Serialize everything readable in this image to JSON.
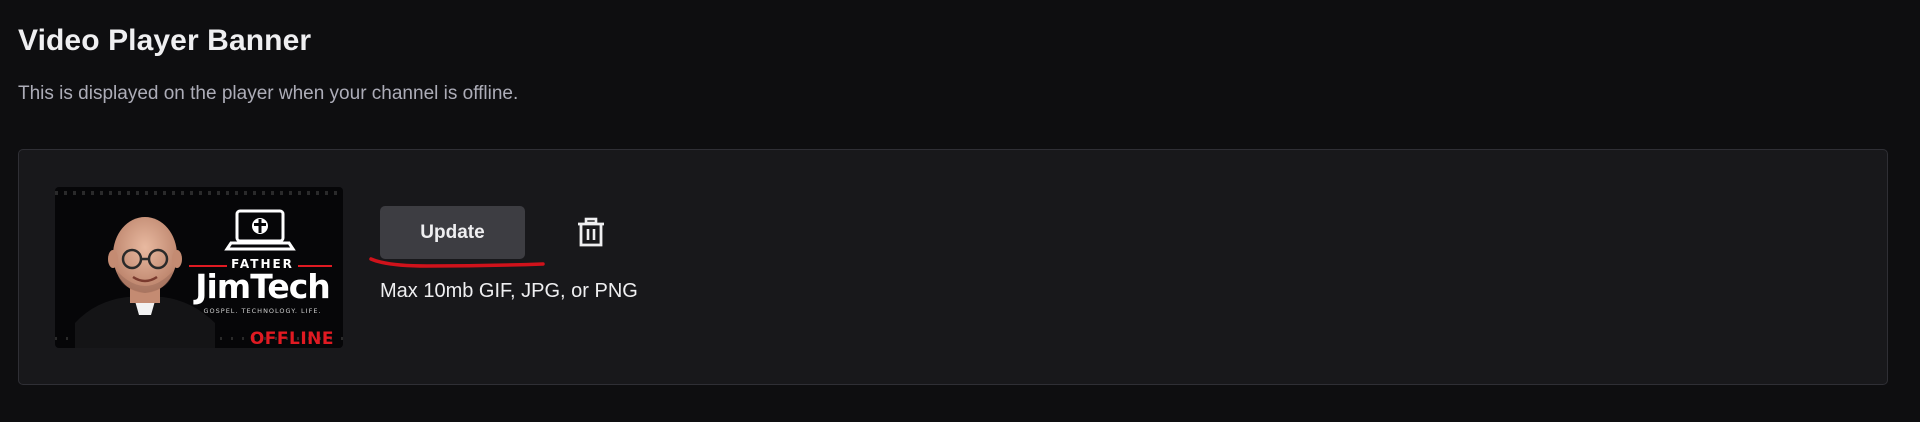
{
  "section": {
    "title": "Video Player Banner",
    "description": "This is displayed on the player when your channel is offline."
  },
  "banner": {
    "image_alt": "Father JimTech offline banner",
    "brand_top": "FATHER",
    "brand_name": "JimTech",
    "brand_tagline": "GOSPEL. TECHNOLOGY. LIFE.",
    "status_text": "OFFLINE"
  },
  "actions": {
    "update_label": "Update",
    "delete_icon": "trash-icon"
  },
  "upload_hint": "Max 10mb GIF, JPG, or PNG",
  "colors": {
    "background": "#0e0e10",
    "card": "#18181b",
    "button": "#3d3d42",
    "annotation": "#d0121b",
    "offline_red": "#e01a22"
  }
}
